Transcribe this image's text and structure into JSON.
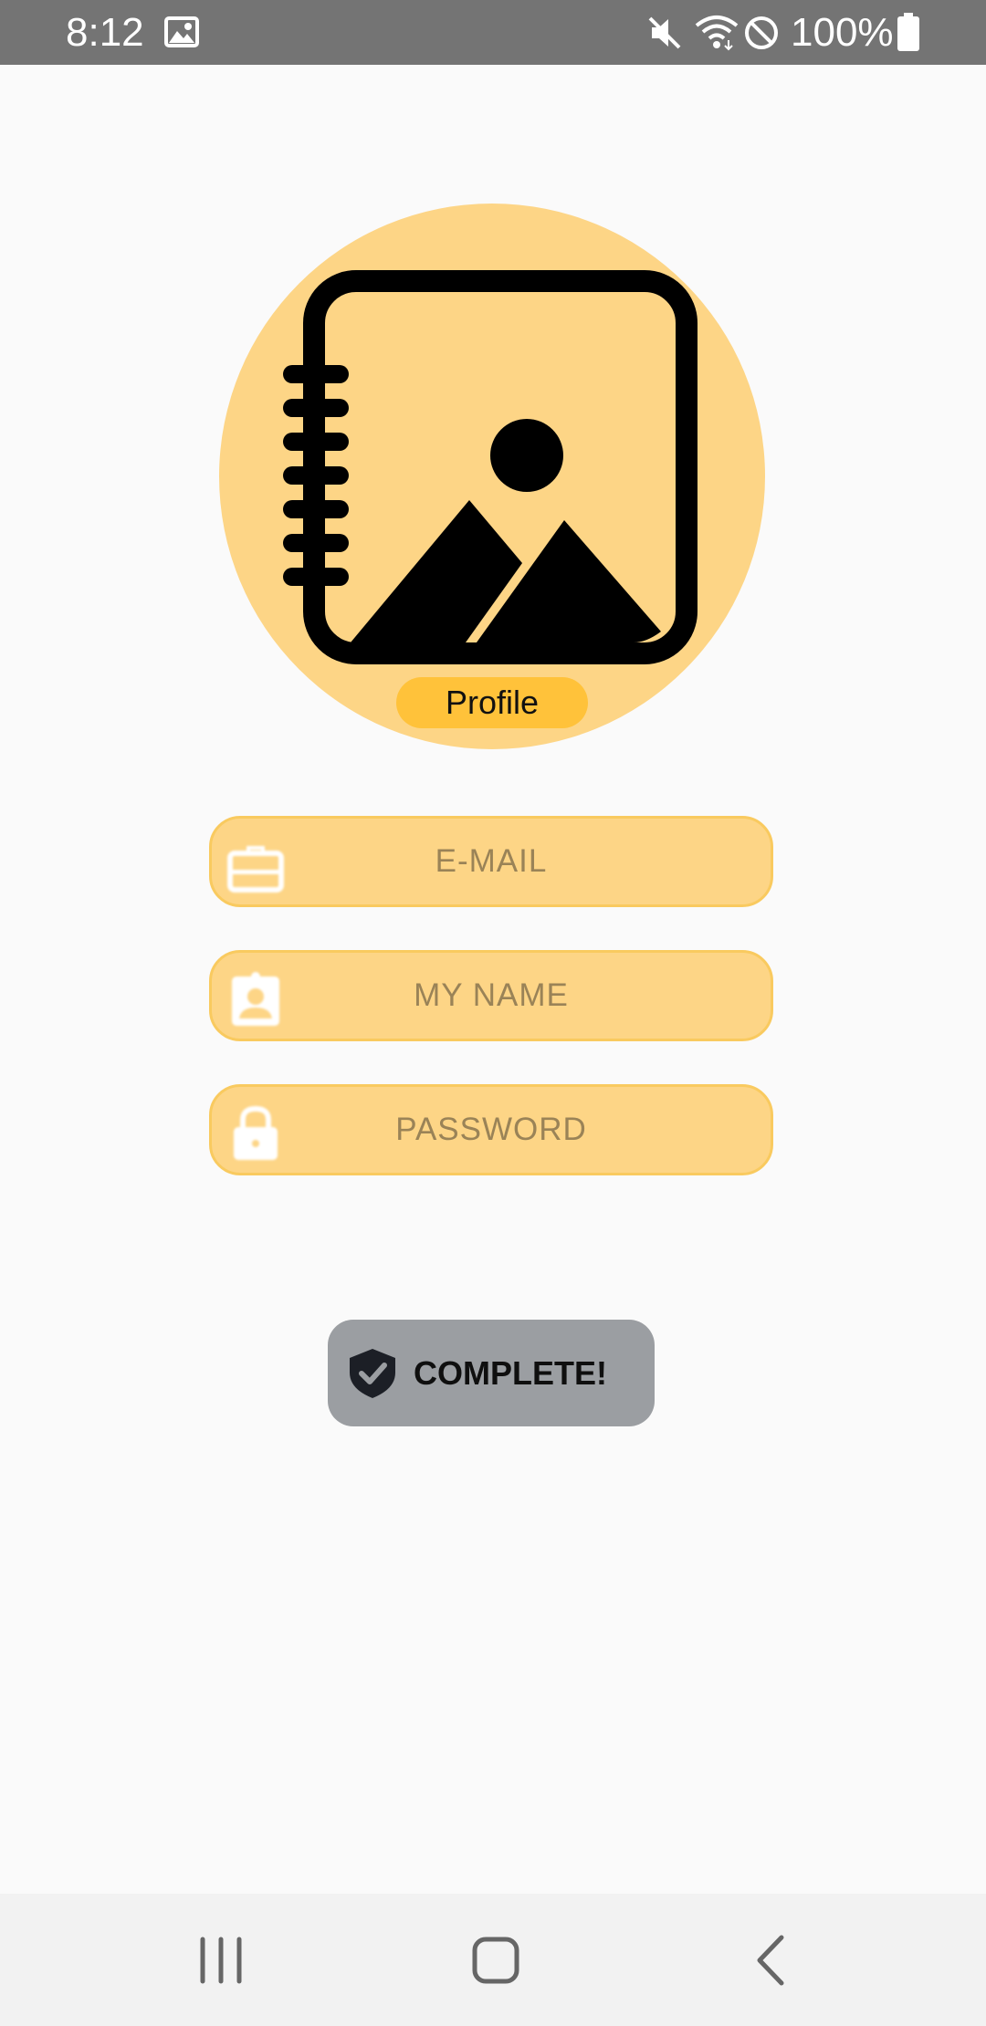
{
  "status_bar": {
    "time": "8:12",
    "battery": "100%",
    "icons": [
      "image-notification-icon",
      "mute-icon",
      "wifi-icon",
      "do-not-disturb-icon",
      "battery-icon"
    ]
  },
  "profile": {
    "icon": "photo-album-icon",
    "label": "Profile"
  },
  "fields": [
    {
      "icon": "briefcase-icon",
      "placeholder": "E-MAIL"
    },
    {
      "icon": "id-badge-icon",
      "placeholder": "MY NAME"
    },
    {
      "icon": "lock-icon",
      "placeholder": "PASSWORD"
    }
  ],
  "complete_button": {
    "icon": "shield-check-icon",
    "label": "COMPLETE!"
  },
  "nav_bar": {
    "icons": [
      "recent-apps-icon",
      "home-icon",
      "back-icon"
    ]
  },
  "colors": {
    "accent": "#fdd586",
    "pill": "#ffc23a",
    "button": "#9b9ea2",
    "status_bar": "#747474"
  }
}
